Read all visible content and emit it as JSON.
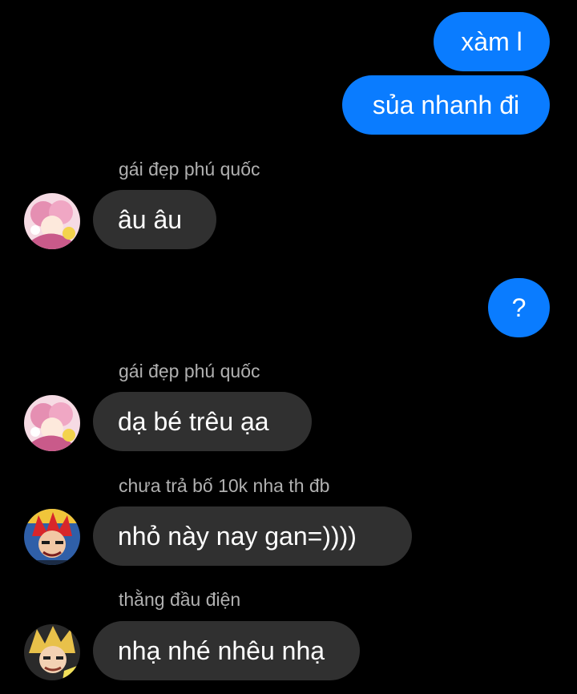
{
  "messages": {
    "m1": {
      "text": "xàm l"
    },
    "m2": {
      "text": "sủa nhanh đi"
    },
    "m3": {
      "sender": "gái đẹp phú quốc",
      "text": "âu âu",
      "avatar": "pink-hair-anime-avatar"
    },
    "m4": {
      "text": "?"
    },
    "m5": {
      "sender": "gái đẹp phú quốc",
      "text": "dạ bé trêu ạa",
      "avatar": "pink-hair-anime-avatar"
    },
    "m6": {
      "sender": "chưa trả bố 10k nha th đb",
      "text": " nhỏ này nay gan=))))",
      "avatar": "red-hair-anime-avatar"
    },
    "m7": {
      "sender": "thằng đầu điện",
      "text": "nhạ nhé nhêu nhạ",
      "avatar": "blonde-hair-anime-avatar"
    }
  },
  "colors": {
    "background": "#000000",
    "outgoing_bubble": "#0A7CFF",
    "incoming_bubble": "#303030",
    "sender_name": "#B0B0B0",
    "text": "#FFFFFF"
  }
}
